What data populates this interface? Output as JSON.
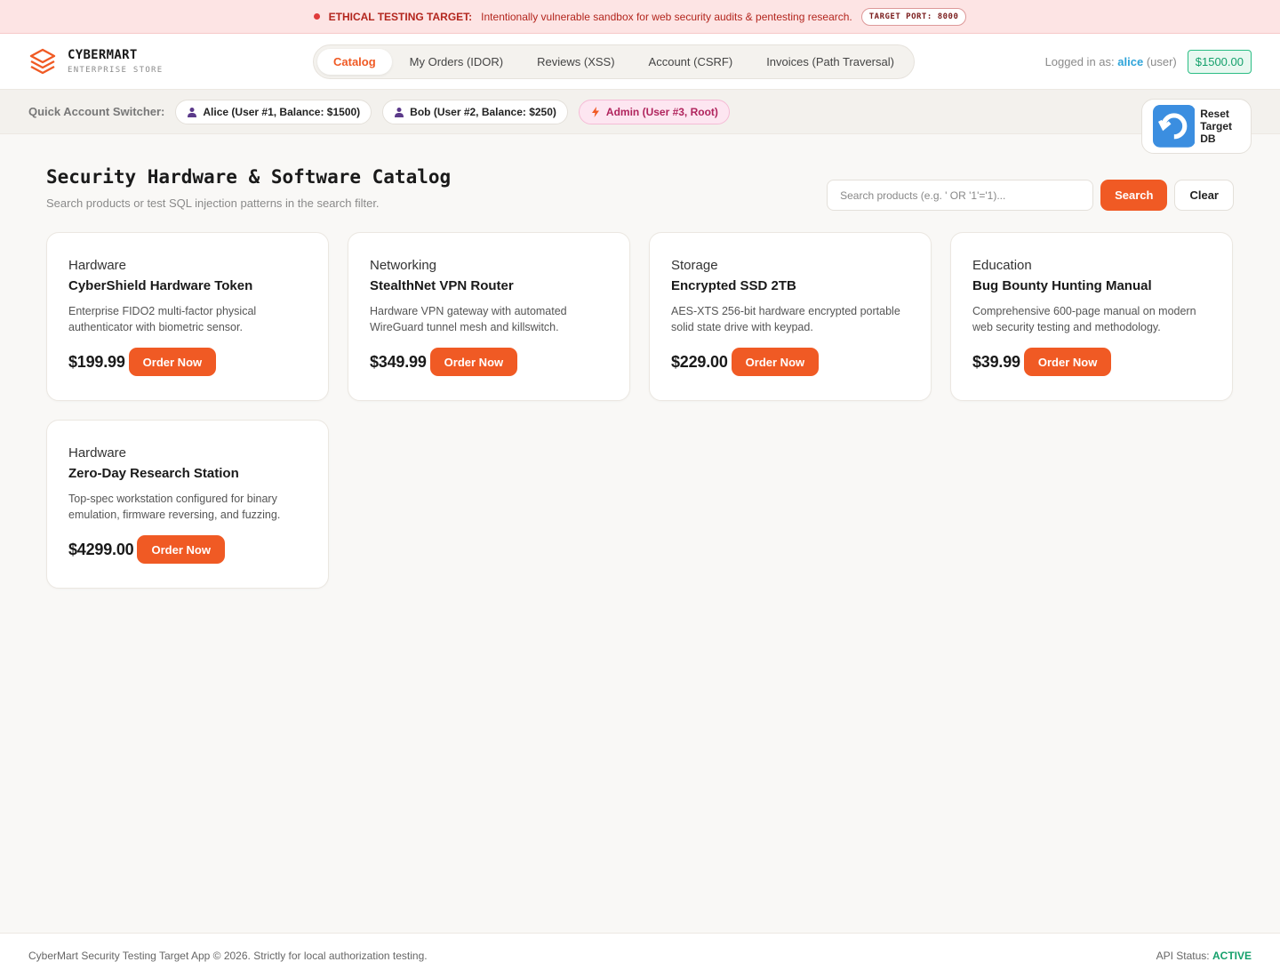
{
  "banner": {
    "title": "ETHICAL TESTING TARGET:",
    "text": "Intentionally vulnerable sandbox for web security audits & pentesting research.",
    "port": "TARGET PORT: 8000"
  },
  "brand": {
    "name": "CYBERMART",
    "subtitle": "ENTERPRISE STORE"
  },
  "nav": {
    "tabs": [
      {
        "label": "Catalog",
        "active": true
      },
      {
        "label": "My Orders (IDOR)"
      },
      {
        "label": "Reviews (XSS)"
      },
      {
        "label": "Account (CSRF)"
      },
      {
        "label": "Invoices (Path Traversal)"
      }
    ]
  },
  "user": {
    "logged_prefix": "Logged in as:",
    "username": "alice",
    "role": "(user)",
    "balance": "$1500.00"
  },
  "switcher": {
    "label": "Quick Account Switcher:",
    "accounts": [
      {
        "label": "Alice (User #1, Balance: $1500)"
      },
      {
        "label": "Bob (User #2, Balance: $250)"
      },
      {
        "label": "Admin (User #3, Root)"
      }
    ],
    "reset_label": "Reset Target DB"
  },
  "catalog": {
    "title": "Security Hardware & Software Catalog",
    "subtitle": "Search products or test SQL injection patterns in the search filter.",
    "search_placeholder": "Search products (e.g. ' OR '1'='1)...",
    "search_label": "Search",
    "clear_label": "Clear",
    "order_label": "Order Now",
    "products": [
      {
        "category": "Hardware",
        "name": "CyberShield Hardware Token",
        "description": "Enterprise FIDO2 multi-factor physical authenticator with biometric sensor.",
        "price": "$199.99"
      },
      {
        "category": "Networking",
        "name": "StealthNet VPN Router",
        "description": "Hardware VPN gateway with automated WireGuard tunnel mesh and killswitch.",
        "price": "$349.99"
      },
      {
        "category": "Storage",
        "name": "Encrypted SSD 2TB",
        "description": "AES-XTS 256-bit hardware encrypted portable solid state drive with keypad.",
        "price": "$229.00"
      },
      {
        "category": "Education",
        "name": "Bug Bounty Hunting Manual",
        "description": "Comprehensive 600-page manual on modern web security testing and methodology.",
        "price": "$39.99"
      },
      {
        "category": "Hardware",
        "name": "Zero-Day Research Station",
        "description": "Top-spec workstation configured for binary emulation, firmware reversing, and fuzzing.",
        "price": "$4299.00"
      }
    ]
  },
  "footer": {
    "copyright": "CyberMart Security Testing Target App © 2026. Strictly for local authorization testing.",
    "api_label": "API Status:",
    "api_value": "ACTIVE"
  },
  "colors": {
    "accent": "#f05a24",
    "success": "#14a06b",
    "danger": "#b3261e",
    "link": "#2fa4d9"
  }
}
